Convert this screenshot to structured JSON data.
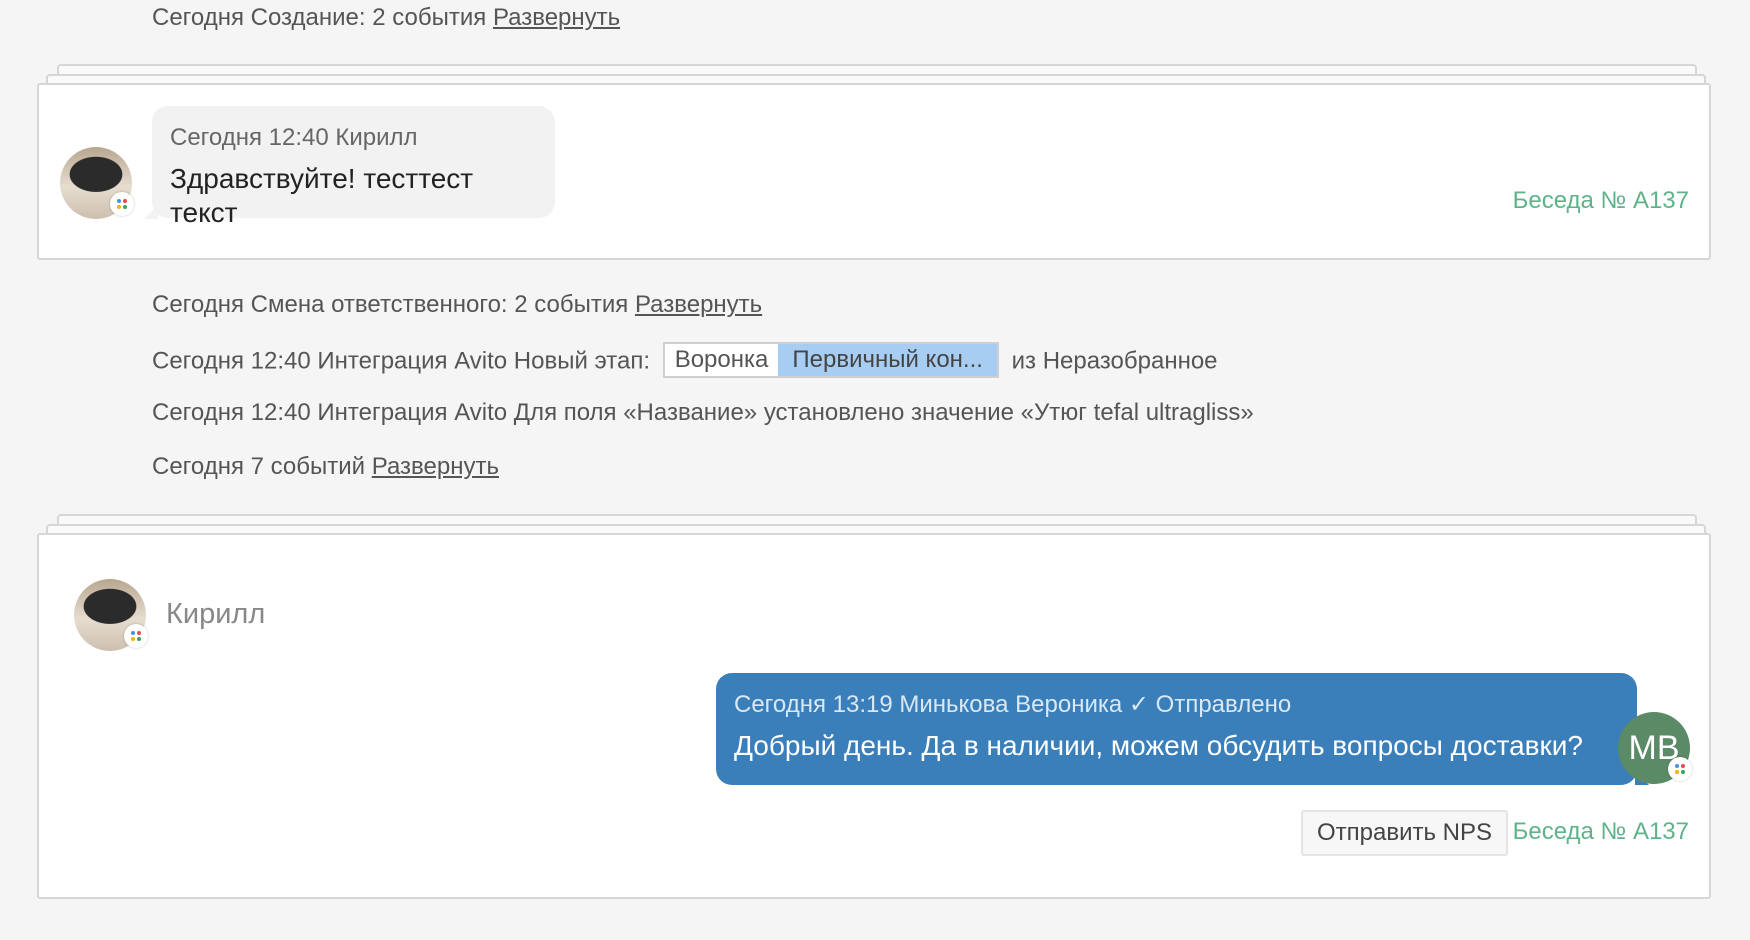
{
  "events_top": {
    "creation": {
      "text": "Сегодня Создание: 2 события",
      "link": "Развернуть"
    }
  },
  "card1": {
    "message": {
      "meta": "Сегодня 12:40 Кирилл",
      "text": "Здравствуйте! тесттест текст"
    },
    "conversation_link": "Беседа № А137"
  },
  "events_mid": {
    "responsible": {
      "text": "Сегодня Смена ответственного: 2 события",
      "link": "Развернуть"
    },
    "stage": {
      "prefix": "Сегодня 12:40 Интеграция Avito Новый этап:",
      "pipeline_label": "Воронка",
      "stage_label": "Первичный кон...",
      "suffix": "из Неразобранное"
    },
    "field": {
      "text": "Сегодня 12:40 Интеграция Avito Для поля «Название» установлено значение «Утюг tefal ultragliss»"
    },
    "seven": {
      "text": "Сегодня 7 событий",
      "link": "Развернуть"
    }
  },
  "card2": {
    "contact_name": "Кирилл",
    "outgoing": {
      "meta": "Сегодня 13:19 Минькова Вероника ✓ Отправлено",
      "text": "Добрый день. Да в наличии, можем обсудить вопросы доставки?"
    },
    "avatar_initials": "MB",
    "nps_button": "Отправить NPS",
    "conversation_link": "Беседа № А137"
  },
  "colors": {
    "outgoing_bubble": "#3a7fba",
    "incoming_bubble": "#f2f2f2",
    "conversation_link": "#5fb38a",
    "stage_highlight": "#a8cdf2",
    "avatar_mb": "#5b8a66"
  },
  "icons": [
    "channel-badge-icon",
    "avatar-photo"
  ]
}
